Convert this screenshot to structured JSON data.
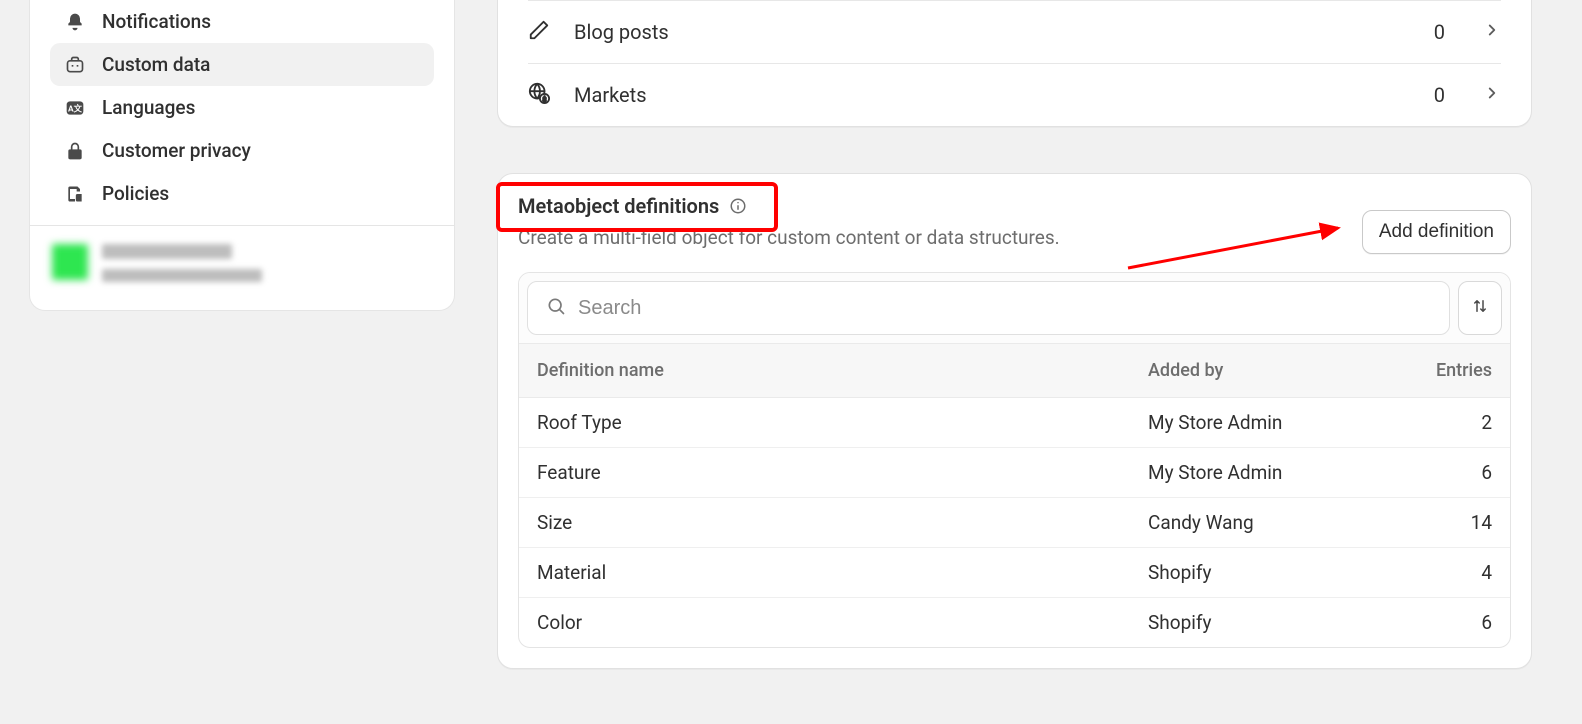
{
  "sidebar": {
    "items": [
      {
        "label": "Notifications"
      },
      {
        "label": "Custom data"
      },
      {
        "label": "Languages"
      },
      {
        "label": "Customer privacy"
      },
      {
        "label": "Policies"
      }
    ]
  },
  "topList": {
    "rows": [
      {
        "label": "Blog posts",
        "count": "0"
      },
      {
        "label": "Markets",
        "count": "0"
      }
    ]
  },
  "meta": {
    "title": "Metaobject definitions",
    "subtitle": "Create a multi-field object for custom content or data structures.",
    "addButton": "Add definition",
    "searchPlaceholder": "Search"
  },
  "table": {
    "headers": {
      "name": "Definition name",
      "addedBy": "Added by",
      "entries": "Entries"
    },
    "rows": [
      {
        "name": "Roof Type",
        "addedBy": "My Store Admin",
        "entries": "2"
      },
      {
        "name": "Feature",
        "addedBy": "My Store Admin",
        "entries": "6"
      },
      {
        "name": "Size",
        "addedBy": "Candy Wang",
        "entries": "14"
      },
      {
        "name": "Material",
        "addedBy": "Shopify",
        "entries": "4"
      },
      {
        "name": "Color",
        "addedBy": "Shopify",
        "entries": "6"
      }
    ]
  }
}
